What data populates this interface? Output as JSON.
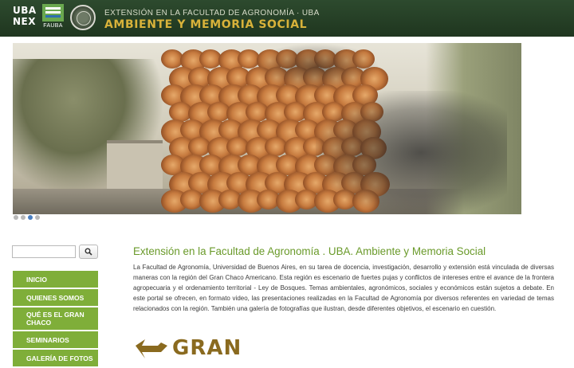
{
  "header": {
    "uba_line1": "UBA",
    "uba_line2": "NEX",
    "fauba_label": "FAUBA",
    "subtitle": "EXTENSIÓN EN LA FACULTAD DE AGRONOMÍA · UBA",
    "title": "AMBIENTE Y MEMORIA SOCIAL"
  },
  "slider": {
    "dots": 4,
    "active_index": 2
  },
  "search": {
    "value": "",
    "icon": "search-icon"
  },
  "nav": {
    "items": [
      {
        "label": "INICIO"
      },
      {
        "label": "QUIENES SOMOS"
      },
      {
        "label": "QUÉ ES EL GRAN CHACO"
      },
      {
        "label": "SEMINARIOS"
      },
      {
        "label": "GALERÍA DE FOTOS"
      }
    ],
    "color": "#7fae39"
  },
  "main": {
    "title": "Extensión en la Facultad de Agronomía . UBA. Ambiente y Memoria Social",
    "body": "La Facultad de Agronomía, Universidad de Buenos Aires, en su tarea de docencia, investigación, desarrollo y extensión está vinculada de diversas maneras con la región del Gran Chaco Americano. Esta región es escenario de fuertes pujas y conflictos de intereses entre el avance de la frontera agropecuaria y el ordenamiento territorial - Ley de Bosques. Temas ambientales, agronómicos, sociales y económicos están sujetos a debate. En este portal se ofrecen, en formato video, las presentaciones realizadas en la Facultad de Agronomía por diversos referentes en variedad de temas relacionados con la región. También una galería de fotografías que ilustran, desde diferentes objetivos, el escenario en cuestión.",
    "logo_text": "GRAN CHACO"
  },
  "colors": {
    "header_bg": "#2d4a2e",
    "title_gold": "#d8b23a",
    "accent_green": "#6a9a2a"
  }
}
